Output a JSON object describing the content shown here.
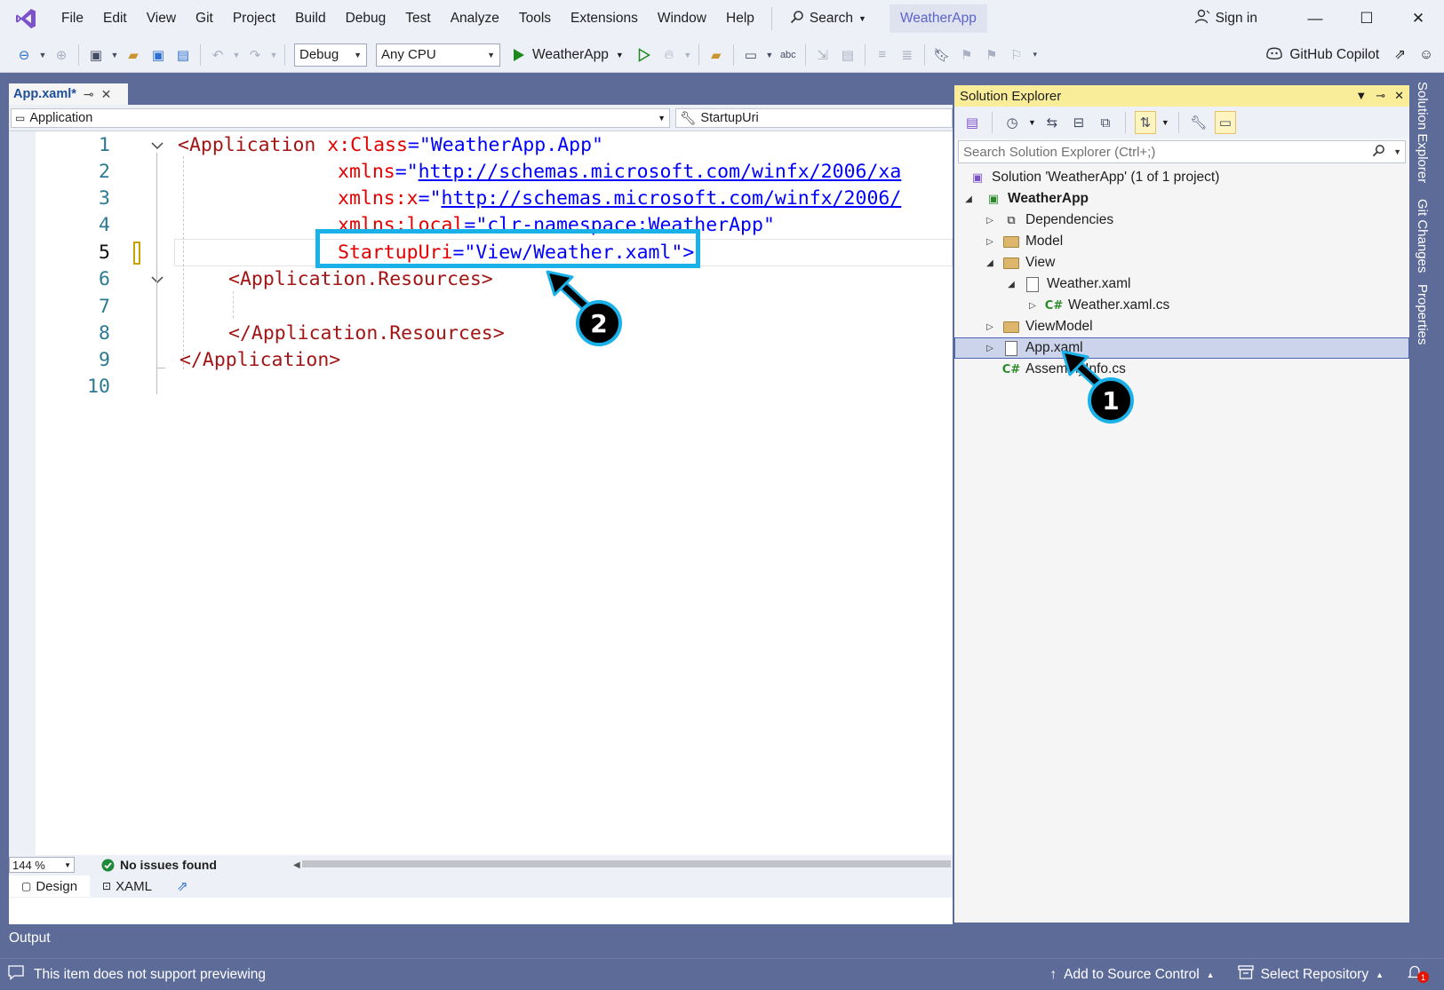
{
  "menu": {
    "items": [
      "File",
      "Edit",
      "View",
      "Git",
      "Project",
      "Build",
      "Debug",
      "Test",
      "Analyze",
      "Tools",
      "Extensions",
      "Window",
      "Help"
    ],
    "search_label": "Search",
    "solution_name": "WeatherApp",
    "sign_in": "Sign in"
  },
  "toolbar": {
    "config": "Debug",
    "platform": "Any CPU",
    "run_target": "WeatherApp",
    "copilot": "GitHub Copilot"
  },
  "editor": {
    "tab_label": "App.xaml*",
    "nav_left": "Application",
    "nav_right": "StartupUri",
    "line_numbers": [
      "1",
      "2",
      "3",
      "4",
      "5",
      "6",
      "7",
      "8",
      "9",
      "10"
    ],
    "active_line": "5",
    "code": {
      "l1_tag": "<Application",
      "l1_attr": "x:Class",
      "l1_val": "\"WeatherApp.App\"",
      "l2_attr": "xmlns",
      "l2_q": "\"",
      "l2_url": "http://schemas.microsoft.com/winfx/2006/xa",
      "l3_attr": "xmlns:x",
      "l3_url": "http://schemas.microsoft.com/winfx/2006/",
      "l4_attr": "xmlns:local",
      "l4_val": "\"clr-namespace:WeatherApp\"",
      "l5_attr": "StartupUri",
      "l5_val": "\"View/Weather.xaml\"",
      "l5_end": ">",
      "l6_tag": "<Application.Resources>",
      "l8_tag": "</Application.Resources>",
      "l9_tag": "</Application>"
    },
    "zoom": "144 %",
    "issues": "No issues found",
    "view_tabs": [
      "Design",
      "XAML"
    ]
  },
  "output_label": "Output",
  "solution_explorer": {
    "title": "Solution Explorer",
    "search_placeholder": "Search Solution Explorer (Ctrl+;)",
    "tree": [
      {
        "label": "Solution 'WeatherApp' (1 of 1 project)"
      },
      {
        "label": "WeatherApp"
      },
      {
        "label": "Dependencies"
      },
      {
        "label": "Model"
      },
      {
        "label": "View"
      },
      {
        "label": "Weather.xaml"
      },
      {
        "label": "Weather.xaml.cs"
      },
      {
        "label": "ViewModel"
      },
      {
        "label": "App.xaml"
      },
      {
        "label": "AssemblyInfo.cs"
      }
    ]
  },
  "side_tabs": [
    "Solution Explorer",
    "Git Changes",
    "Properties"
  ],
  "callouts": [
    "1",
    "2"
  ],
  "status": {
    "preview_msg": "This item does not support previewing",
    "add_source": "Add to Source Control",
    "select_repo": "Select Repository",
    "notif_count": "1"
  },
  "colors": {
    "chrome": "#5d6b99",
    "callout": "#1ab0e8",
    "xml_tag": "#a31515",
    "xml_attr": "#e50000",
    "xml_value": "#0000ff"
  }
}
